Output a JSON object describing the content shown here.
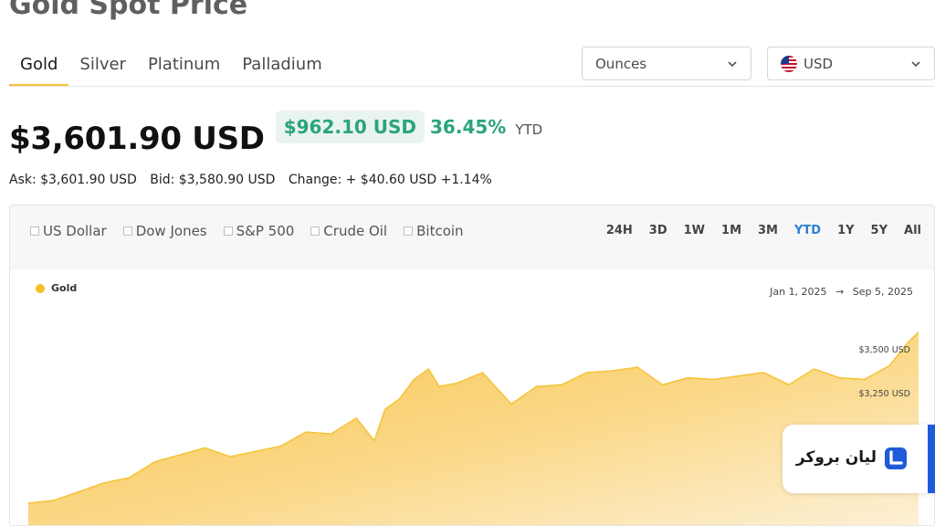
{
  "page": {
    "title": "Gold Spot Price"
  },
  "metal_tabs": [
    {
      "label": "Gold",
      "active": true
    },
    {
      "label": "Silver",
      "active": false
    },
    {
      "label": "Platinum",
      "active": false
    },
    {
      "label": "Palladium",
      "active": false
    }
  ],
  "unit_select": {
    "value": "Ounces"
  },
  "currency_select": {
    "value": "USD"
  },
  "price": {
    "main": "$3,601.90 USD",
    "change_amount": "$962.10 USD",
    "change_pct": "36.45%",
    "period": "YTD"
  },
  "quote": {
    "ask": "Ask: $3,601.90 USD",
    "bid": "Bid: $3,580.90 USD",
    "change": "Change: + $40.60 USD +1.14%"
  },
  "compare": [
    {
      "label": "US Dollar",
      "checked": false
    },
    {
      "label": "Dow Jones",
      "checked": false
    },
    {
      "label": "S&P 500",
      "checked": false
    },
    {
      "label": "Crude Oil",
      "checked": false
    },
    {
      "label": "Bitcoin",
      "checked": false
    }
  ],
  "ranges": [
    {
      "label": "24H",
      "active": false
    },
    {
      "label": "3D",
      "active": false
    },
    {
      "label": "1W",
      "active": false
    },
    {
      "label": "1M",
      "active": false
    },
    {
      "label": "3M",
      "active": false
    },
    {
      "label": "YTD",
      "active": true
    },
    {
      "label": "1Y",
      "active": false
    },
    {
      "label": "5Y",
      "active": false
    },
    {
      "label": "All",
      "active": false
    }
  ],
  "chart": {
    "legend": "Gold",
    "date_from": "Jan 1, 2025",
    "date_arrow": "→",
    "date_to": "Sep 5, 2025",
    "y_ticks": [
      "$3,500 USD",
      "$3,250 USD"
    ]
  },
  "colors": {
    "accent_gold": "#f5c026",
    "positive": "#2aa57a",
    "active_range": "#2f7fd4",
    "brand_blue": "#1f5bd8"
  },
  "chart_data": {
    "type": "area",
    "x": [
      "2025-01-01",
      "2025-01-08",
      "2025-01-15",
      "2025-01-22",
      "2025-01-29",
      "2025-02-05",
      "2025-02-12",
      "2025-02-19",
      "2025-02-26",
      "2025-03-05",
      "2025-03-12",
      "2025-03-19",
      "2025-03-26",
      "2025-04-02",
      "2025-04-07",
      "2025-04-10",
      "2025-04-14",
      "2025-04-18",
      "2025-04-22",
      "2025-04-25",
      "2025-04-30",
      "2025-05-07",
      "2025-05-15",
      "2025-05-22",
      "2025-05-29",
      "2025-06-05",
      "2025-06-12",
      "2025-06-19",
      "2025-06-26",
      "2025-07-03",
      "2025-07-10",
      "2025-07-17",
      "2025-07-24",
      "2025-07-31",
      "2025-08-07",
      "2025-08-14",
      "2025-08-21",
      "2025-08-28",
      "2025-09-02",
      "2025-09-05"
    ],
    "series": [
      {
        "name": "Gold",
        "values": [
          2625,
          2640,
          2690,
          2740,
          2770,
          2860,
          2900,
          2940,
          2890,
          2920,
          2950,
          3030,
          3020,
          3110,
          2980,
          3160,
          3220,
          3330,
          3390,
          3290,
          3310,
          3370,
          3190,
          3290,
          3300,
          3370,
          3380,
          3400,
          3300,
          3340,
          3330,
          3350,
          3370,
          3300,
          3390,
          3340,
          3330,
          3410,
          3540,
          3600
        ]
      }
    ],
    "y_ticks": [
      3250,
      3500
    ],
    "legend": "top-left",
    "grid": false
  }
}
